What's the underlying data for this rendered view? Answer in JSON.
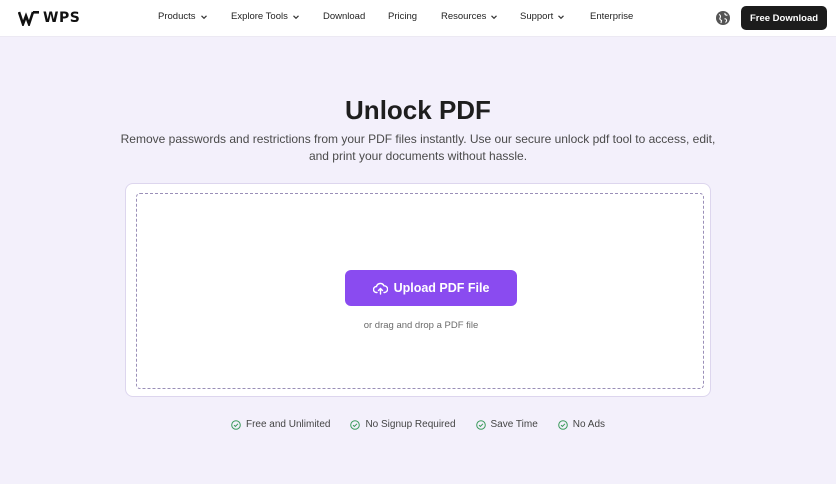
{
  "header": {
    "logo_text": "WPS",
    "nav": [
      {
        "label": "Products",
        "dropdown": true
      },
      {
        "label": "Explore Tools",
        "dropdown": true
      },
      {
        "label": "Download",
        "dropdown": false
      },
      {
        "label": "Pricing",
        "dropdown": false
      },
      {
        "label": "Resources",
        "dropdown": true
      },
      {
        "label": "Support",
        "dropdown": true
      },
      {
        "label": "Enterprise",
        "dropdown": false
      }
    ],
    "cta_label": "Free Download"
  },
  "hero": {
    "title": "Unlock PDF",
    "subtitle": "Remove passwords and restrictions from your PDF files instantly. Use our secure unlock pdf tool to access, edit, and print your documents without hassle."
  },
  "upload": {
    "button_label": "Upload PDF File",
    "hint": "or drag and drop a PDF file"
  },
  "features": [
    "Free and Unlimited",
    "No Signup Required",
    "Save Time",
    "No Ads"
  ],
  "colors": {
    "accent": "#8a4bf0",
    "page_bg": "#f3f0fb",
    "cta_bg": "#1c1c1c",
    "check_green": "#3a9a5b"
  }
}
